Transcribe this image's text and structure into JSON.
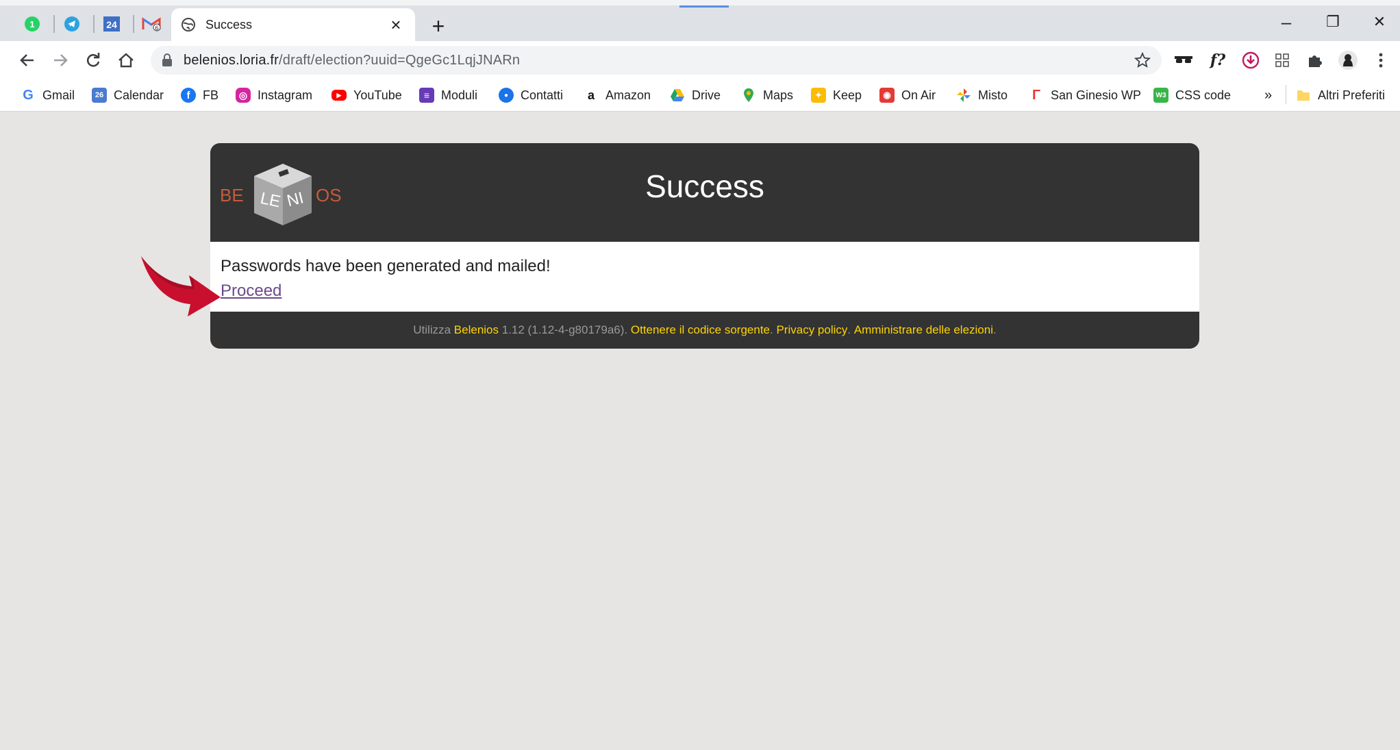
{
  "browser": {
    "pinned_tabs": [
      {
        "name": "whatsapp",
        "glyph": "1",
        "color": "#25d366"
      },
      {
        "name": "telegram",
        "glyph": "✈",
        "color": "#2aa3e0"
      },
      {
        "name": "calendar-24",
        "glyph": "24",
        "color": "#3f6fc6"
      },
      {
        "name": "gmail",
        "glyph": "M",
        "color": "#ea4335"
      }
    ],
    "active_tab": {
      "title": "Success",
      "icon": "globe-icon"
    },
    "url": {
      "host": "belenios.loria.fr",
      "path": "/draft/election?uuid=QgeGc1LqjJNARn"
    },
    "window_controls": {
      "minimize": "–",
      "restore": "❐",
      "close": "✕"
    }
  },
  "bookmarks": [
    {
      "label": "Gmail",
      "icon": "google-icon",
      "color": "#4285f4",
      "glyph": "G"
    },
    {
      "label": "Calendar",
      "icon": "calendar-icon",
      "color": "#4a7bd0",
      "glyph": "26"
    },
    {
      "label": "FB",
      "icon": "facebook-icon",
      "color": "#1877f2",
      "glyph": "f"
    },
    {
      "label": "Instagram",
      "icon": "instagram-icon",
      "color": "#d6249f",
      "glyph": "◎"
    },
    {
      "label": "YouTube",
      "icon": "youtube-icon",
      "color": "#ff0000",
      "glyph": "▶"
    },
    {
      "label": "Moduli",
      "icon": "forms-icon",
      "color": "#673ab7",
      "glyph": "≡"
    },
    {
      "label": "Contatti",
      "icon": "contacts-icon",
      "color": "#1a73e8",
      "glyph": "●"
    },
    {
      "label": "Amazon",
      "icon": "amazon-icon",
      "color": "#222222",
      "glyph": "a"
    },
    {
      "label": "Drive",
      "icon": "drive-icon",
      "color": "#1fa463",
      "glyph": "▲"
    },
    {
      "label": "Maps",
      "icon": "maps-icon",
      "color": "#34a853",
      "glyph": "⬤"
    },
    {
      "label": "Keep",
      "icon": "keep-icon",
      "color": "#fbbc04",
      "glyph": "💡"
    },
    {
      "label": "On Air",
      "icon": "on-air-icon",
      "color": "#e53935",
      "glyph": "◉"
    },
    {
      "label": "Misto",
      "icon": "pinwheel-icon",
      "color": "#ea4335",
      "glyph": "✤"
    },
    {
      "label": "San Ginesio WP",
      "icon": "wordpress-icon",
      "color": "#e53935",
      "glyph": "Γ"
    },
    {
      "label": "CSS code",
      "icon": "code-icon",
      "color": "#3ab54a",
      "glyph": "W3"
    }
  ],
  "bookmarks_overflow": "»",
  "other_bookmarks": "Altri Preferiti",
  "page": {
    "logo": {
      "left": "BE",
      "cube_top": "LE",
      "cube_right": "NI",
      "right": "OS"
    },
    "title": "Success",
    "message": "Passwords have been generated and mailed!",
    "proceed_link": "Proceed",
    "footer": {
      "prefix": "Utilizza",
      "app_name": "Belenios",
      "version": "1.12 (1.12-4-g80179a6).",
      "source_link": "Ottenere il codice sorgente",
      "privacy_link": "Privacy policy",
      "admin_link": "Amministrare delle elezioni"
    }
  },
  "colors": {
    "header_bg": "#333333",
    "link_visited": "#6b4a8a",
    "footer_link": "#ffd400",
    "annotation_arrow": "#c8102e"
  }
}
